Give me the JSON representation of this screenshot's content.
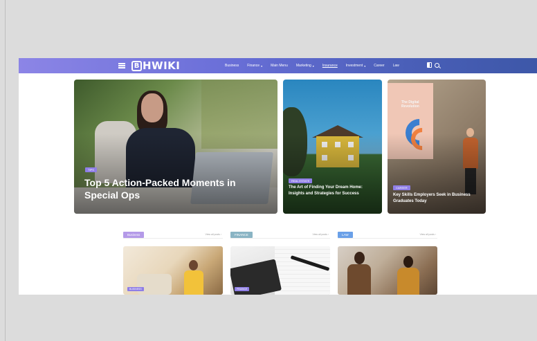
{
  "brand": {
    "logo_mark": "B",
    "logo_text": "HWIKI"
  },
  "nav": {
    "items": [
      {
        "label": "Business",
        "has_menu": false
      },
      {
        "label": "Finance",
        "has_menu": true
      },
      {
        "label": "Main Menu",
        "has_menu": false
      },
      {
        "label": "Marketing",
        "has_menu": true
      },
      {
        "label": "Insurance",
        "has_menu": false,
        "active": true
      },
      {
        "label": "Investment",
        "has_menu": true
      },
      {
        "label": "Career",
        "has_menu": false
      },
      {
        "label": "Law",
        "has_menu": false
      }
    ]
  },
  "featured": {
    "hero": {
      "badge": "TIPS",
      "title": "Top 5 Action-Packed Moments in Special Ops"
    },
    "house": {
      "badge": "REAL ESTATE",
      "title": "The Art of Finding Your Dream Home: Insights and Strategies for Success"
    },
    "presentation": {
      "badge": "CAREER",
      "title": "Key Skills Employers Seek in Business Graduates Today",
      "screen_text": "The Digital Revolution"
    }
  },
  "sections": [
    {
      "tag": "Business",
      "more": "View all posts ›",
      "badge": "BUSINESS"
    },
    {
      "tag": "FINANCE",
      "more": "View all posts ›",
      "badge": "FINANCE"
    },
    {
      "tag": "LAW",
      "more": "View all posts ›"
    }
  ],
  "colors": {
    "nav_gradient_start": "#8c85e6",
    "nav_gradient_end": "#3d57a8",
    "badge": "#8f7ee6"
  }
}
